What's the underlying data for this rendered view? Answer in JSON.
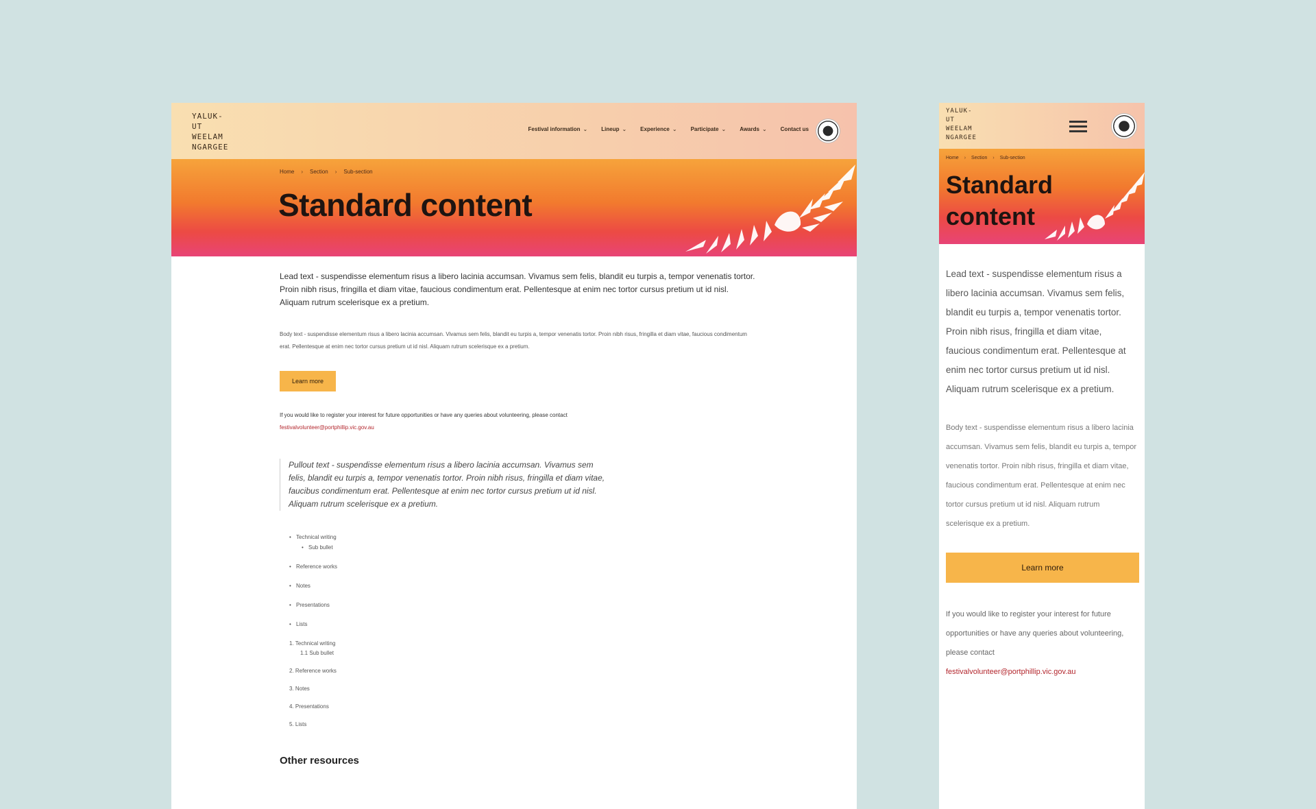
{
  "brand": {
    "logo_text": "YALUK-UT WEELAM NGARGEE"
  },
  "nav": {
    "items": [
      {
        "label": "Festival information",
        "has_dropdown": true
      },
      {
        "label": "Lineup",
        "has_dropdown": true
      },
      {
        "label": "Experience",
        "has_dropdown": true
      },
      {
        "label": "Participate",
        "has_dropdown": true
      },
      {
        "label": "Awards",
        "has_dropdown": true
      },
      {
        "label": "Contact us",
        "has_dropdown": false
      }
    ],
    "chevron": "⌄"
  },
  "breadcrumb": {
    "items": [
      "Home",
      "Section",
      "Sub-section"
    ],
    "separator": "›"
  },
  "page": {
    "title": "Standard content",
    "lead": "Lead text - suspendisse elementum risus a libero lacinia accumsan. Vivamus sem felis, blandit eu turpis a, tempor venenatis tortor. Proin nibh risus, fringilla et diam vitae, faucious condimentum erat. Pellentesque at enim nec tortor cursus pretium ut id nisl. Aliquam rutrum scelerisque ex a pretium.",
    "body": "Body text - suspendisse elementum risus a libero lacinia accumsan. Vivamus sem felis, blandit eu turpis a, tempor venenatis tortor. Proin nibh risus, fringilla et diam vitae, faucious condimentum erat. Pellentesque at enim nec tortor cursus pretium ut id nisl. Aliquam rutrum scelerisque ex a pretium.",
    "button_label": "Learn more",
    "contact_text": "If you would like to register your interest for future opportunities or have any queries about volunteering, please contact",
    "contact_email": "festivalvolunteer@portphillip.vic.gov.au",
    "pullout": "Pullout text - suspendisse elementum risus a libero lacinia accumsan. Vivamus sem felis, blandit eu turpis a, tempor venenatis tortor. Proin nibh risus, fringilla et diam vitae, faucibus condimentum erat. Pellentesque at enim nec tortor cursus pretium ut id nisl. Aliquam rutrum scelerisque ex a pretium.",
    "bullets": [
      "Technical writing",
      "Sub bullet",
      "Reference works",
      "Notes",
      "Presentations",
      "Lists"
    ],
    "numbered": [
      "1. Technical writing",
      "1.1 Sub bullet",
      "2. Reference works",
      "3. Notes",
      "4. Presentations",
      "5. Lists"
    ],
    "resources_title": "Other resources"
  },
  "colors": {
    "page_bg": "#d0e2e2",
    "header_bg": "#f8d6ae",
    "hero_top": "#f6a33b",
    "hero_bottom": "#e84476",
    "button": "#f7b54a",
    "link": "#b3262d"
  },
  "icons": [
    "city-seal-icon",
    "hamburger-menu-icon",
    "chevron-down-icon",
    "leaf-decoration-icon"
  ]
}
